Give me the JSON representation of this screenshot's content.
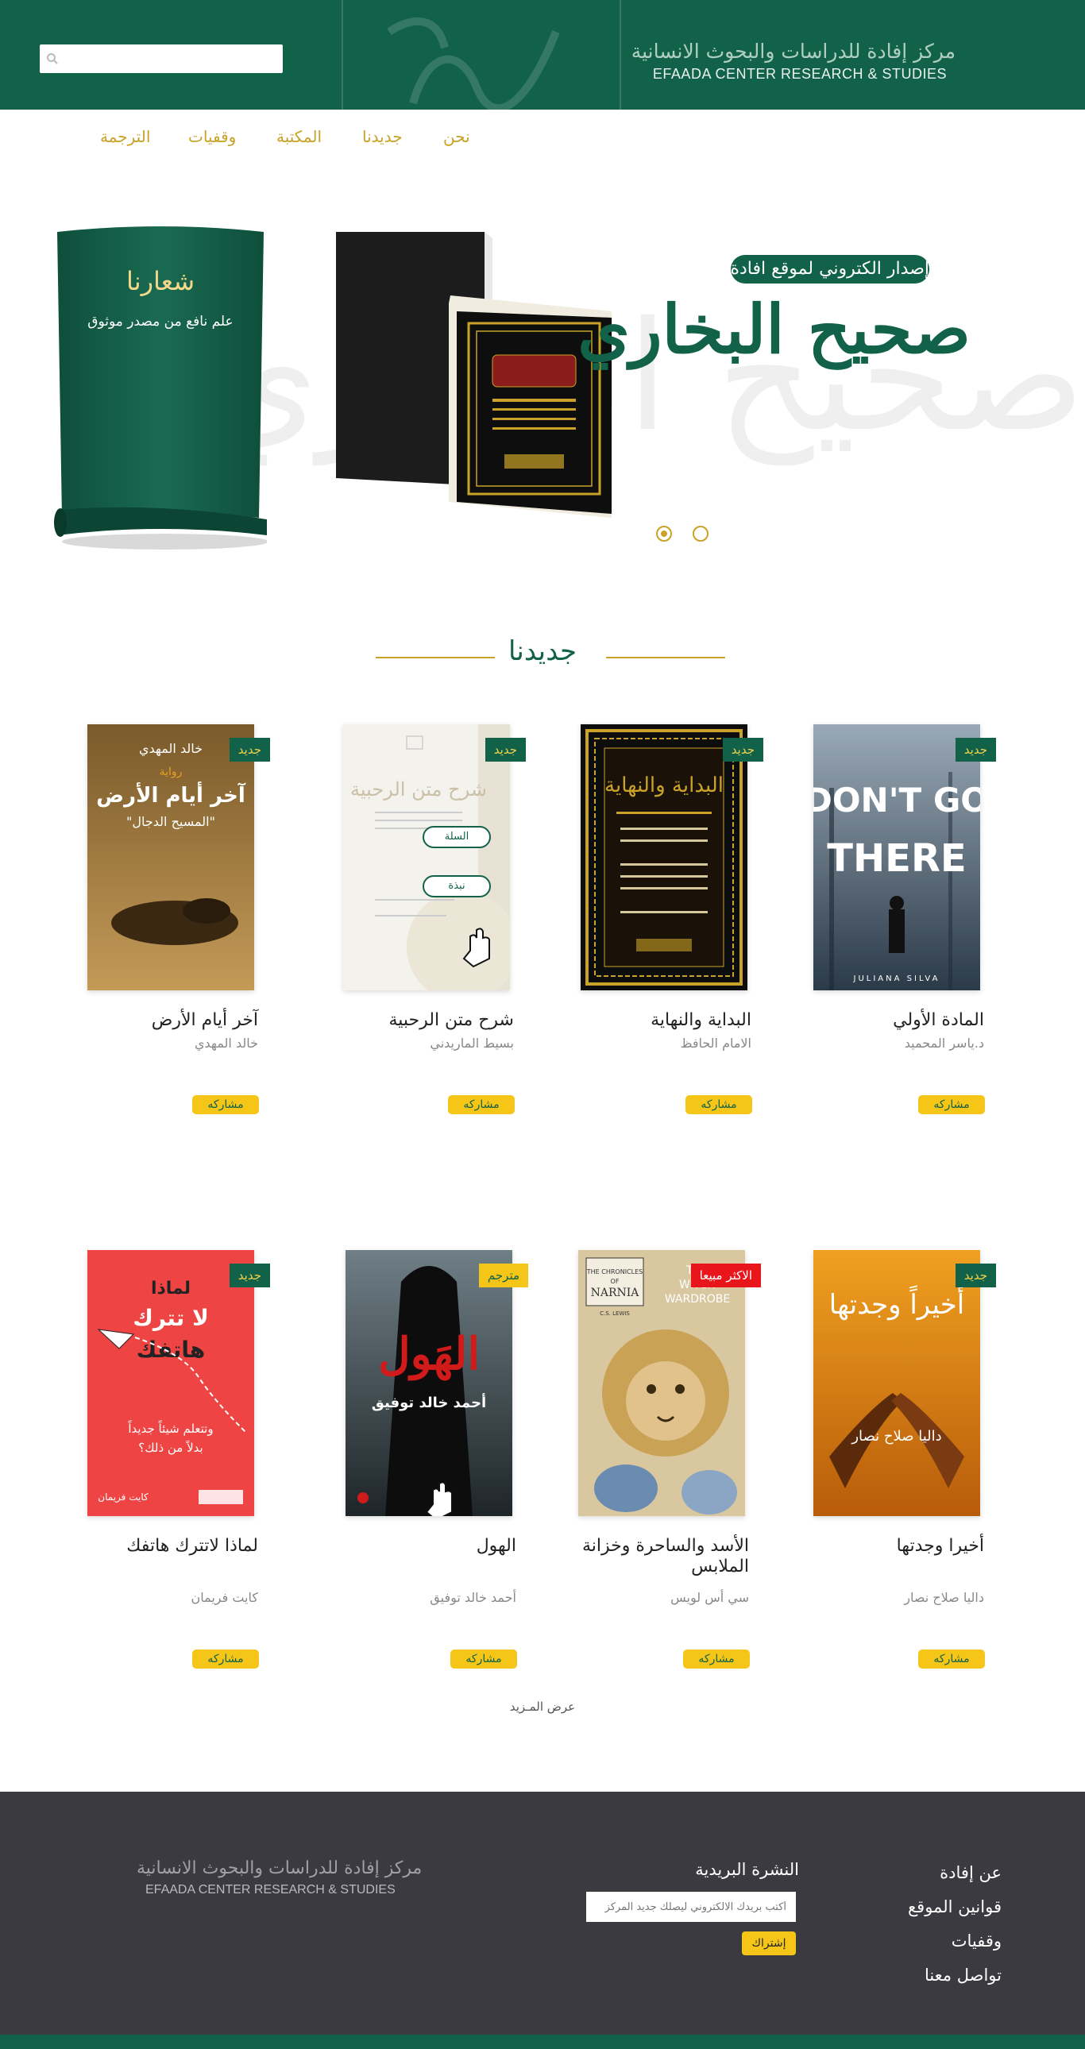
{
  "header": {
    "logo_ar": "مركز إفادة للدراسات والبحوث الانسانية",
    "logo_en": "EFAADA CENTER RESEARCH & STUDIES",
    "search": {
      "placeholder": "",
      "value": ""
    }
  },
  "nav": {
    "items": [
      {
        "label": "نحن"
      },
      {
        "label": "جديدنا"
      },
      {
        "label": "المكتبة"
      },
      {
        "label": "وقفيات"
      },
      {
        "label": "الترجمة"
      }
    ]
  },
  "hero": {
    "scroll_title": "شعارنا",
    "scroll_subtitle": "علم نافع من مصدر موثوق",
    "badge_text": "إصدار الكتروني لموقع افادة",
    "calligraphy": "صحيح البخاري",
    "watermark": "صحيح البخاري",
    "slides_count": 2,
    "active_slide": 1
  },
  "section": {
    "title": "جديدنا"
  },
  "books": [
    {
      "title": "المادة الأولي",
      "author": "د.ياسر المحميد",
      "badge": "جديد",
      "badge_type": "new",
      "share": "مشاركه",
      "cover_text": "DON'T GO THERE",
      "cover_sub": "JULIANA SILVA"
    },
    {
      "title": "البداية والنهاية",
      "author": "الامام الحافظ",
      "badge": "جديد",
      "badge_type": "new",
      "share": "مشاركه",
      "cover_text": "البداية والنهاية"
    },
    {
      "title": "شرح متن الرحبية",
      "author": "بسيط الماريدني",
      "badge": "جديد",
      "badge_type": "new",
      "share": "مشاركه",
      "cover_text": "شرح متن الرحبية",
      "overlay_cart": "السلة",
      "overlay_brief": "نبذة"
    },
    {
      "title": "آخر أيام الأرض",
      "author": "خالد المهدي",
      "badge": "جديد",
      "badge_type": "new",
      "share": "مشاركه",
      "cover_text": "آخر أيام الأرض",
      "cover_sub": "\"المسيح الدجال\"",
      "cover_author": "خالد المهدي",
      "cover_kind": "رواية"
    },
    {
      "title": "أخيرا وجدتها",
      "author": "داليا صلاح نصار",
      "badge": "جديد",
      "badge_type": "new",
      "share": "مشاركه",
      "cover_text": "أخيراً وجدتها",
      "cover_author": "داليا صلاح نصار"
    },
    {
      "title": "الأسد والساحرة وخزانة الملابس",
      "author": "سي أس لويس",
      "badge": "الاكثر مبيعا",
      "badge_type": "best",
      "share": "مشاركه",
      "cover_text": "THE WITCH AND THE WARDROBE",
      "cover_sub": "THE CHRONICLES OF NARNIA",
      "cover_author": "C.S. LEWIS"
    },
    {
      "title": "الهول",
      "author": "أحمد خالد توفيق",
      "badge": "مترجم",
      "badge_type": "trans",
      "share": "مشاركه",
      "cover_text": "الهَول",
      "cover_author": "أحمد خالد توفيق"
    },
    {
      "title": "لماذا لاتترك هاتفك",
      "author": "كايت فريمان",
      "badge": "جديد",
      "badge_type": "new",
      "share": "مشاركه",
      "cover_text": "لماذا لا تترك هاتفك",
      "cover_sub": "وتتعلم شيئاً جديداً بدلاً من ذلك؟",
      "cover_author": "كايت فريمان"
    }
  ],
  "more_label": "عرض المـزيد",
  "footer": {
    "links": [
      {
        "label": "عن إفادة"
      },
      {
        "label": "قوانين الموقع"
      },
      {
        "label": "وقفيات"
      },
      {
        "label": "تواصل معنا"
      }
    ],
    "newsletter_title": "النشرة البريدية",
    "newsletter_placeholder": "أكتب بريدك الالكتروني ليصلك جديد المركز",
    "subscribe_label": "إشتراك",
    "logo_ar": "مركز إفادة للدراسات والبحوث الانسانية",
    "logo_en": "EFAADA CENTER RESEARCH & STUDIES"
  },
  "colors": {
    "brand_green": "#116249",
    "gold": "#c9a227",
    "yellow": "#f5c518",
    "best_red": "#e8161b",
    "footer_bg": "#3a3a40"
  }
}
